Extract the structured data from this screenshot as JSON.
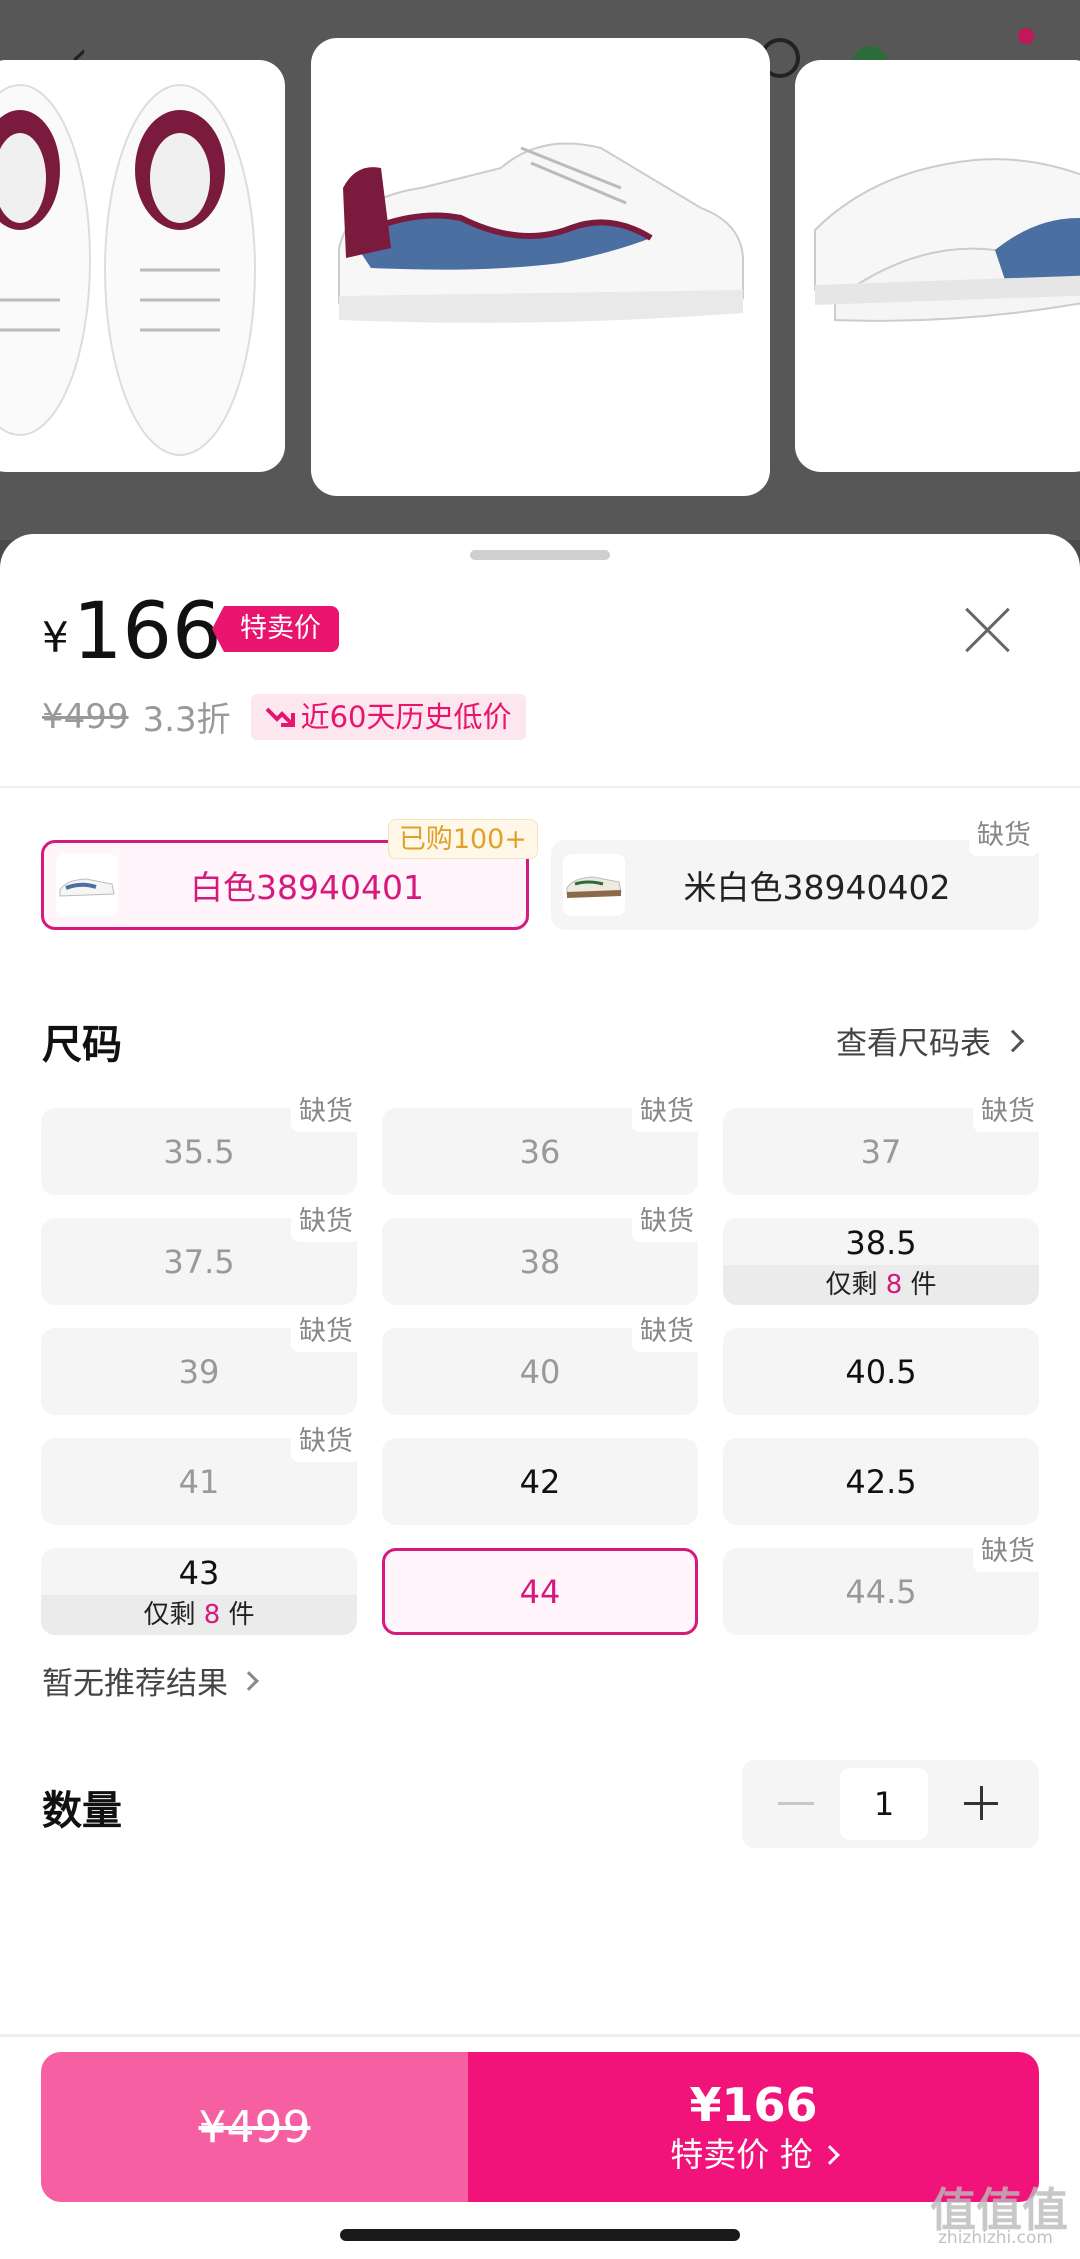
{
  "product": {
    "currency": "¥",
    "price": "166",
    "special_tag": "特卖价",
    "original_price": "¥499",
    "discount": "3.3折",
    "lowest_badge": "近60天历史低价"
  },
  "colors": [
    {
      "label": "白色38940401",
      "tag": "已购100+",
      "selected": true
    },
    {
      "label": "米白色38940402",
      "tag": "缺货",
      "selected": false
    }
  ],
  "size_section": {
    "title": "尺码",
    "chart_link": "查看尺码表"
  },
  "sizes": [
    {
      "value": "35.5",
      "tag": "缺货"
    },
    {
      "value": "36",
      "tag": "缺货"
    },
    {
      "value": "37",
      "tag": "缺货"
    },
    {
      "value": "37.5",
      "tag": "缺货"
    },
    {
      "value": "38",
      "tag": "缺货"
    },
    {
      "value": "38.5",
      "stock_prefix": "仅剩",
      "stock_num": "8",
      "stock_suffix": "件"
    },
    {
      "value": "39",
      "tag": "缺货"
    },
    {
      "value": "40",
      "tag": "缺货"
    },
    {
      "value": "40.5"
    },
    {
      "value": "41",
      "tag": "缺货"
    },
    {
      "value": "42"
    },
    {
      "value": "42.5"
    },
    {
      "value": "43",
      "stock_prefix": "仅剩",
      "stock_num": "8",
      "stock_suffix": "件"
    },
    {
      "value": "44",
      "selected": true
    },
    {
      "value": "44.5",
      "tag": "缺货"
    }
  ],
  "recommend": "暂无推荐结果",
  "quantity": {
    "title": "数量",
    "value": "1"
  },
  "buy_bar": {
    "original": "¥499",
    "price": "¥166",
    "action": "特卖价 抢"
  },
  "watermark": {
    "main": "值值值",
    "sub": "zhizhizhi.com"
  },
  "colors_theme": {
    "accent": "#e8146e",
    "accent_light": "#f75fa3",
    "warn_text": "#e0a12a"
  }
}
